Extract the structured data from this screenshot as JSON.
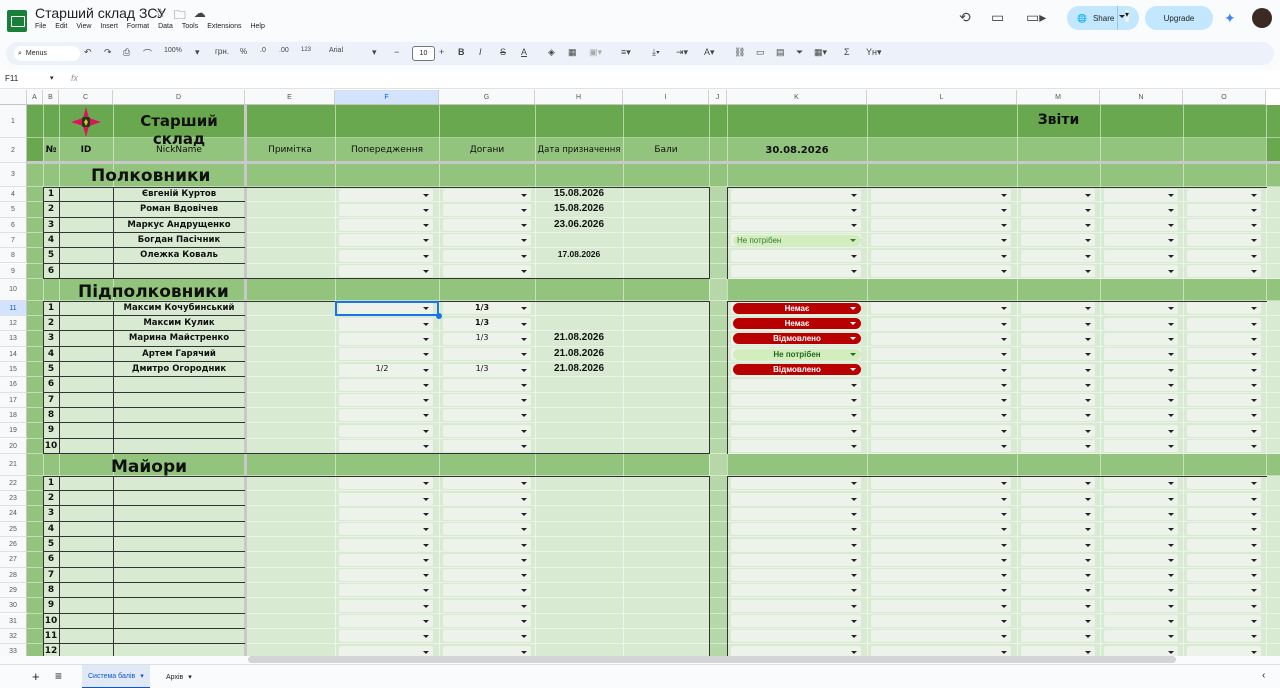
{
  "app": {
    "doc_title": "Старший склад ЗСУ",
    "menu": [
      "File",
      "Edit",
      "View",
      "Insert",
      "Format",
      "Data",
      "Tools",
      "Extensions",
      "Help"
    ],
    "share_label": "Share",
    "upgrade_label": "Upgrade"
  },
  "toolbar": {
    "search_label": "Menus",
    "zoom": "100%",
    "currency": "грн.",
    "percent": "%",
    "dec_less": ".0",
    "dec_more": ".00",
    "format_123": "123",
    "font": "Arial",
    "font_size": "10"
  },
  "formula_bar": {
    "cell_ref": "F11",
    "fx": "fx"
  },
  "columns": [
    "A",
    "B",
    "C",
    "D",
    "E",
    "F",
    "G",
    "H",
    "I",
    "J",
    "K",
    "L",
    "M",
    "N",
    "O"
  ],
  "selected_col": "F",
  "selected_row": 11,
  "sheet": {
    "title": "Старший склад",
    "reports_title": "Звіти",
    "report_date": "30.08.2026",
    "headers": {
      "no": "№",
      "id": "ID",
      "nick": "NickName",
      "note": "Примітка",
      "warnings": "Попередження",
      "reprimands": "Догани",
      "date": "Дата призначення",
      "points": "Бали"
    },
    "sections": [
      {
        "title": "Полковники"
      },
      {
        "title": "Підполковники"
      },
      {
        "title": "Майори"
      }
    ],
    "colonels": [
      {
        "no": "1",
        "name": "Євгеній Куртов",
        "date": "15.08.2026"
      },
      {
        "no": "2",
        "name": "Роман Вдовічев",
        "date": "15.08.2026"
      },
      {
        "no": "3",
        "name": "Маркус Андрущенко",
        "date": "23.06.2026"
      },
      {
        "no": "4",
        "name": "Богдан Пасічник",
        "date": "",
        "k_status": "Не потрібен"
      },
      {
        "no": "5",
        "name": "Олежка Коваль",
        "date": "17.08.2026"
      },
      {
        "no": "6",
        "name": "",
        "date": ""
      }
    ],
    "lt_colonels": [
      {
        "no": "1",
        "name": "Максим Кочубинський",
        "warn": "",
        "rep": "1/3",
        "date": "",
        "k_status": "Немає"
      },
      {
        "no": "2",
        "name": "Максим Кулик",
        "warn": "",
        "rep": "1/3",
        "date": "",
        "k_status": "Немає"
      },
      {
        "no": "3",
        "name": "Марина Майстренко",
        "warn": "",
        "rep": "1/3",
        "date": "21.08.2026",
        "k_status": "Відмовлено"
      },
      {
        "no": "4",
        "name": "Артем Гарячий",
        "warn": "",
        "rep": "",
        "date": "21.08.2026",
        "k_status": "Не потрібен"
      },
      {
        "no": "5",
        "name": "Дмитро Огородник",
        "warn": "1/2",
        "rep": "1/3",
        "date": "21.08.2026",
        "k_status": "Відмовлено"
      },
      {
        "no": "6",
        "name": "",
        "warn": "",
        "rep": "",
        "date": ""
      },
      {
        "no": "7",
        "name": "",
        "warn": "",
        "rep": "",
        "date": ""
      },
      {
        "no": "8",
        "name": "",
        "warn": "",
        "rep": "",
        "date": ""
      },
      {
        "no": "9",
        "name": "",
        "warn": "",
        "rep": "",
        "date": ""
      },
      {
        "no": "10",
        "name": "",
        "warn": "",
        "rep": "",
        "date": ""
      }
    ],
    "majors": [
      "1",
      "2",
      "3",
      "4",
      "5",
      "6",
      "7",
      "8",
      "9",
      "10",
      "11",
      "12"
    ]
  },
  "status_colors": {
    "Немає": "#b80000",
    "Відмовлено": "#b80000",
    "Не потрібен": "#d4edbc"
  },
  "tabs": [
    {
      "label": "Система балів",
      "active": true
    },
    {
      "label": "Архів",
      "active": false
    }
  ]
}
